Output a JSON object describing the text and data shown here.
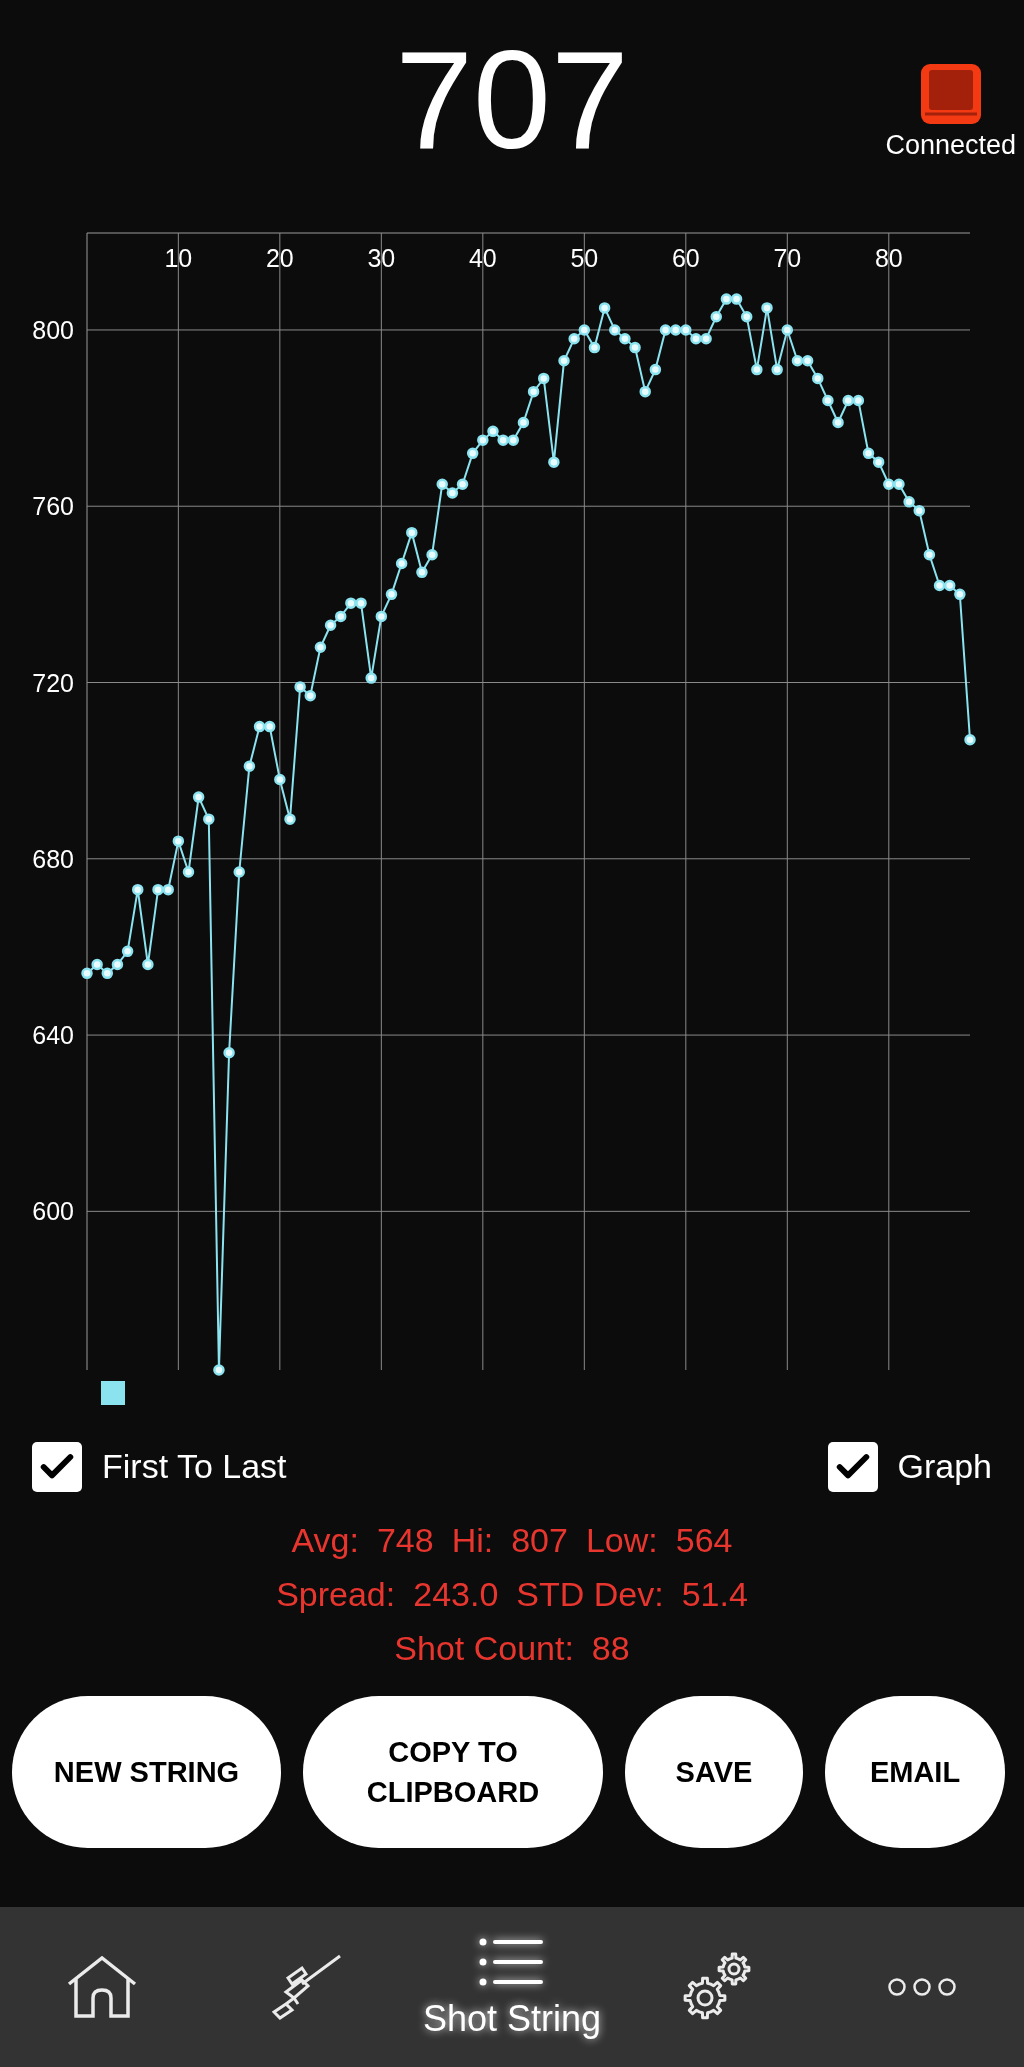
{
  "reading": "707",
  "connection": {
    "label": "Connected"
  },
  "chart_data": {
    "type": "line",
    "x": [
      1,
      2,
      3,
      4,
      5,
      6,
      7,
      8,
      9,
      10,
      11,
      12,
      13,
      14,
      15,
      16,
      17,
      18,
      19,
      20,
      21,
      22,
      23,
      24,
      25,
      26,
      27,
      28,
      29,
      30,
      31,
      32,
      33,
      34,
      35,
      36,
      37,
      38,
      39,
      40,
      41,
      42,
      43,
      44,
      45,
      46,
      47,
      48,
      49,
      50,
      51,
      52,
      53,
      54,
      55,
      56,
      57,
      58,
      59,
      60,
      61,
      62,
      63,
      64,
      65,
      66,
      67,
      68,
      69,
      70,
      71,
      72,
      73,
      74,
      75,
      76,
      77,
      78,
      79,
      80,
      81,
      82,
      83,
      84,
      85,
      86,
      87,
      88
    ],
    "grid": true,
    "series": [
      {
        "color": "#8be3f0",
        "marker": true,
        "values": [
          654,
          656,
          654,
          656,
          659,
          673,
          656,
          673,
          673,
          684,
          677,
          694,
          689,
          564,
          636,
          677,
          701,
          710,
          710,
          698,
          689,
          719,
          717,
          728,
          733,
          735,
          738,
          738,
          721,
          735,
          740,
          747,
          754,
          745,
          749,
          765,
          763,
          765,
          772,
          775,
          777,
          775,
          775,
          779,
          786,
          789,
          770,
          793,
          798,
          800,
          796,
          805,
          800,
          798,
          796,
          786,
          791,
          800,
          800,
          800,
          798,
          798,
          803,
          807,
          807,
          803,
          791,
          805,
          791,
          800,
          793,
          793,
          789,
          784,
          779,
          784,
          784,
          772,
          770,
          765,
          765,
          761,
          759,
          749,
          742,
          742,
          740,
          707
        ]
      }
    ],
    "xlim": [
      1,
      88
    ],
    "ylim": [
      564,
      822
    ],
    "xticks": [
      10,
      20,
      30,
      40,
      50,
      60,
      70,
      80
    ],
    "yticks": [
      600,
      640,
      680,
      720,
      760,
      800
    ]
  },
  "options": [
    {
      "label": "First To Last",
      "checked": true
    },
    {
      "label": "Graph",
      "checked": true
    }
  ],
  "stats": [
    [
      {
        "label": "Avg:",
        "value": "748"
      },
      {
        "label": "Hi:",
        "value": "807"
      },
      {
        "label": "Low:",
        "value": "564"
      }
    ],
    [
      {
        "label": "Spread:",
        "value": "243.0"
      },
      {
        "label": "STD Dev:",
        "value": "51.4"
      }
    ],
    [
      {
        "label": "Shot Count:",
        "value": "88"
      }
    ]
  ],
  "buttons": [
    "NEW STRING",
    "COPY TO CLIPBOARD",
    "SAVE",
    "EMAIL"
  ],
  "nav": [
    {
      "kind": "home",
      "selected": false
    },
    {
      "kind": "rifle",
      "selected": false
    },
    {
      "kind": "list",
      "label": "Shot String",
      "selected": true
    },
    {
      "kind": "gears",
      "selected": false
    },
    {
      "kind": "more",
      "selected": false
    }
  ]
}
